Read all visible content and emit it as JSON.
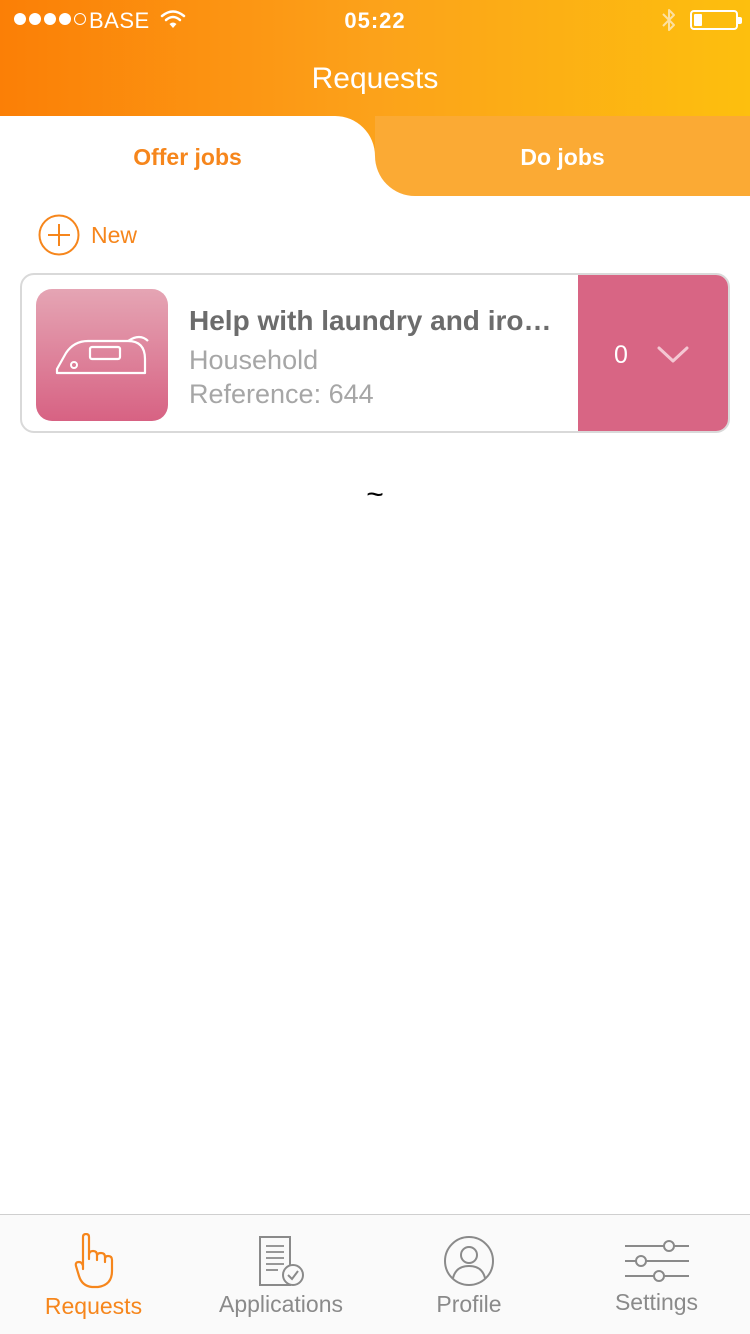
{
  "status_bar": {
    "carrier": "BASE",
    "time": "05:22",
    "signal_dots": 4,
    "battery_level": 0.2
  },
  "header": {
    "title": "Requests"
  },
  "segments": [
    {
      "label": "Offer jobs",
      "selected": true
    },
    {
      "label": "Do jobs",
      "selected": false
    }
  ],
  "new_button": {
    "label": "New"
  },
  "jobs": [
    {
      "title": "Help with laundry and ironing",
      "title_display": "Help with laundry and iro…",
      "category": "Household",
      "reference_label": "Reference: ",
      "reference_value": "644",
      "count": "0",
      "icon": "iron-icon"
    }
  ],
  "loading_glyph": "~",
  "tabbar": {
    "items": [
      {
        "label": "Requests",
        "icon": "pointing-hand-icon",
        "active": true
      },
      {
        "label": "Applications",
        "icon": "document-check-icon",
        "active": false
      },
      {
        "label": "Profile",
        "icon": "person-circle-icon",
        "active": false
      },
      {
        "label": "Settings",
        "icon": "sliders-icon",
        "active": false
      }
    ]
  },
  "colors": {
    "accent": "#f6861c",
    "header_gradient_start": "#fb7f06",
    "header_gradient_end": "#fdbf0e",
    "job_pink": "#d86584",
    "inactive_tab": "#fbaa34"
  }
}
